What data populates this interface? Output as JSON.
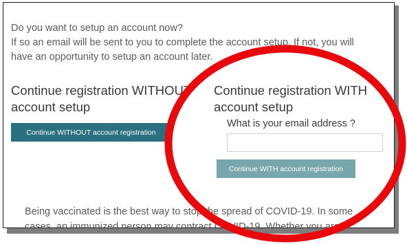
{
  "intro": {
    "line1": "Do you want to setup an account now?",
    "line2": "If so an email will be sent to you to complete the account setup. If not, you will",
    "line3": "have an opportunity to setup an account later."
  },
  "without_column": {
    "title": "Continue registration WITHOUT account setup",
    "button_label": "Continue WITHOUT account registration"
  },
  "with_column": {
    "title": "Continue registration WITH account setup",
    "email_label": "What is your email address ?",
    "email_value": "",
    "button_label": "Continue WITH account registration"
  },
  "bottom": {
    "line1": "Being vaccinated is the best way to stop the spread of COVID-19. In some",
    "line2": "cases, an immunized person may contract COVID-19. Whether you are"
  },
  "colors": {
    "primary_button": "#2b7080",
    "secondary_button": "#78a6ad",
    "annotation": "#e8090d"
  }
}
